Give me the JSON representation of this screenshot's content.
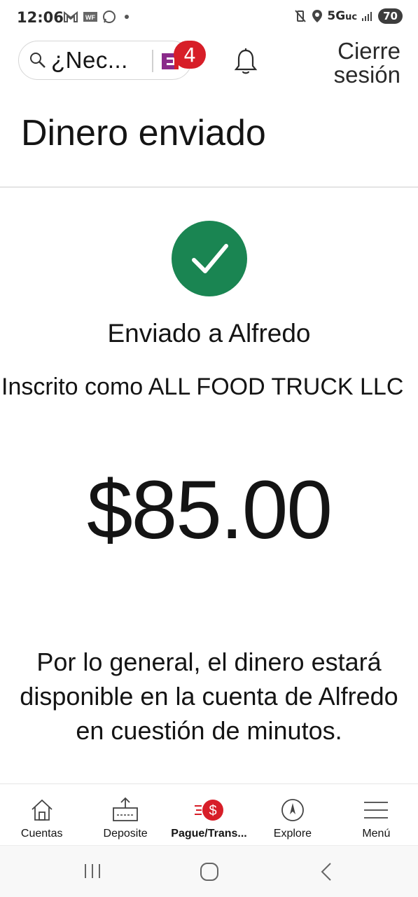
{
  "status_bar": {
    "time": "12:06",
    "network": "5G",
    "network_suffix": "uc",
    "battery": "70"
  },
  "header": {
    "search_text": "¿Nec...",
    "notification_count": "4",
    "logout_label": "Cierre sesión"
  },
  "page": {
    "title": "Dinero enviado"
  },
  "confirmation": {
    "sent_to": "Enviado a Alfredo",
    "enrolled_as": "Inscrito como ALL FOOD TRUCK LLC",
    "amount": "$85.00",
    "info": "Por lo general, el dinero estará disponible en la cuenta de Alfredo en cuestión de minutos."
  },
  "bottom_nav": {
    "items": [
      {
        "label": "Cuentas",
        "icon": "house-icon"
      },
      {
        "label": "Deposite",
        "icon": "deposit-icon"
      },
      {
        "label": "Pague/Trans...",
        "icon": "pay-transfer-icon"
      },
      {
        "label": "Explore",
        "icon": "compass-icon"
      },
      {
        "label": "Menú",
        "icon": "menu-icon"
      }
    ]
  },
  "colors": {
    "success": "#1a8552",
    "accent_red": "#d71e28",
    "brand_purple": "#8a2a8a"
  }
}
